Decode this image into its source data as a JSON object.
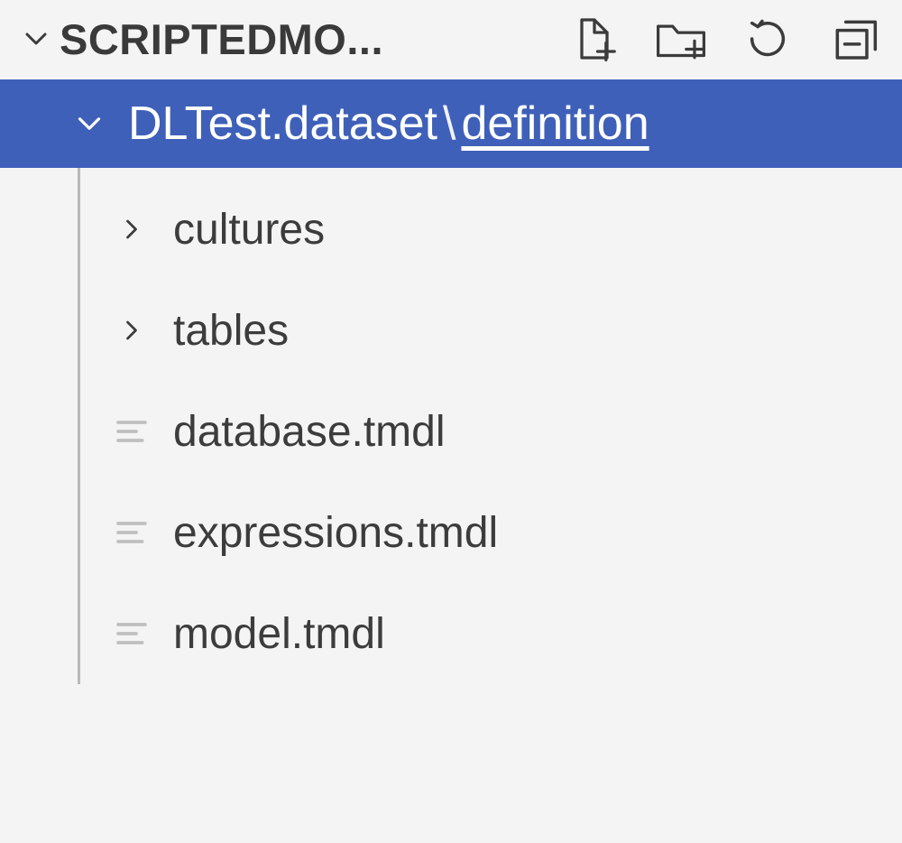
{
  "header": {
    "section_label": "SCRIPTEDMO..."
  },
  "selection": {
    "parent": "DLTest.dataset",
    "separator": "\\",
    "leaf": "definition"
  },
  "children": [
    {
      "kind": "folder",
      "label": "cultures"
    },
    {
      "kind": "folder",
      "label": "tables"
    },
    {
      "kind": "file",
      "label": "database.tmdl"
    },
    {
      "kind": "file",
      "label": "expressions.tmdl"
    },
    {
      "kind": "file",
      "label": "model.tmdl"
    }
  ]
}
